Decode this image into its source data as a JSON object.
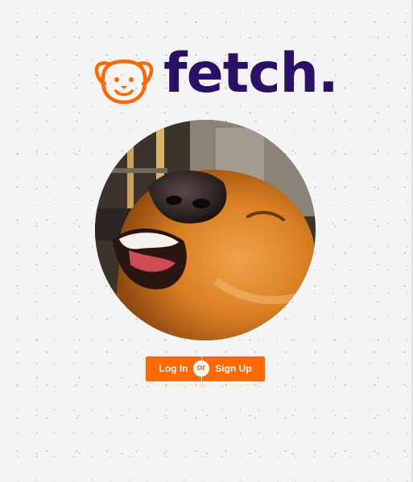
{
  "brand": {
    "name": "fetch.",
    "logo_icon": "dog-face-icon",
    "accent_color": "#ff6900",
    "text_color": "#2a1166"
  },
  "hero": {
    "image": "golden-retriever-photo"
  },
  "auth": {
    "login_label": "Log In",
    "divider_label": "or",
    "signup_label": "Sign Up"
  }
}
